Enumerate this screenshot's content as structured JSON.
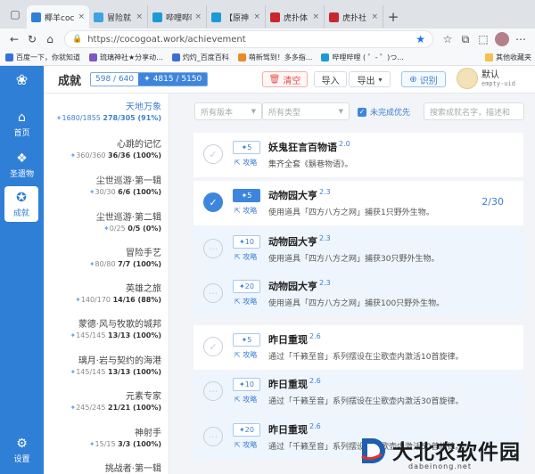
{
  "browser": {
    "tabs": [
      {
        "title": "椰羊coc",
        "color": "#2f7fd6",
        "active": true
      },
      {
        "title": "冒险就",
        "color": "#3ea3e0"
      },
      {
        "title": "哔哩哔哩",
        "color": "#1c9ad6"
      },
      {
        "title": "【原神",
        "color": "#1c9ad6"
      },
      {
        "title": "虎扑体",
        "color": "#c9272d"
      },
      {
        "title": "虎扑社",
        "color": "#c9272d"
      }
    ],
    "url": "https://cocogoat.work/achievement",
    "bookmarks": [
      {
        "label": "百度一下，你就知道",
        "color": "#3b6fd8"
      },
      {
        "label": "琉璃神社★分享动...",
        "color": "#7e57c2"
      },
      {
        "label": "灼灼_百度百科",
        "color": "#3b6fd8"
      },
      {
        "label": "萌新驾到！多多指...",
        "color": "#e98a2b"
      },
      {
        "label": "哔哩哔哩 ( ゜- ゜)つ...",
        "color": "#1c9ad6"
      }
    ],
    "bookmarks_right": "其他收藏夹"
  },
  "header": {
    "title": "成就",
    "count": "598 / 640",
    "primogems": "4815 / 5150",
    "clear": "清空",
    "import": "导入",
    "export": "导出",
    "recognize": "识别",
    "user_name": "默认",
    "user_uid": "empty-uid"
  },
  "sidebar": [
    {
      "label": "首页",
      "icon": "home-icon",
      "glyph": "⌂"
    },
    {
      "label": "圣遗物",
      "icon": "artifact-icon",
      "glyph": "❖"
    },
    {
      "label": "成就",
      "icon": "achievement-icon",
      "glyph": "✪",
      "active": true
    },
    {
      "label": "设置",
      "icon": "gear-icon",
      "glyph": "⚙"
    }
  ],
  "categories": [
    {
      "name": "天地万象",
      "primo": "1680/1855",
      "count": "278/305 (91%)",
      "active": true
    },
    {
      "name": "心跳的记忆",
      "primo": "360/360",
      "count": "36/36 (100%)"
    },
    {
      "name": "尘世巡游·第一辑",
      "primo": "30/30",
      "count": "6/6 (100%)"
    },
    {
      "name": "尘世巡游·第二辑",
      "primo": "0/25",
      "count": "0/5 (0%)"
    },
    {
      "name": "冒险手艺",
      "primo": "80/80",
      "count": "7/7 (100%)"
    },
    {
      "name": "英雄之旅",
      "primo": "140/170",
      "count": "14/16 (88%)"
    },
    {
      "name": "蒙德·风与牧歌的城邦",
      "primo": "145/145",
      "count": "13/13 (100%)"
    },
    {
      "name": "璃月·岩与契约的海港",
      "primo": "145/145",
      "count": "13/13 (100%)"
    },
    {
      "name": "元素专家",
      "primo": "245/245",
      "count": "21/21 (100%)"
    },
    {
      "name": "神射手",
      "primo": "15/15",
      "count": "3/3 (100%)"
    },
    {
      "name": "挑战者·第一辑"
    }
  ],
  "filters": {
    "version": "所有版本",
    "type": "所有类型",
    "incomplete_first": "未完成优先",
    "search_placeholder": "搜索成就名字，描述和"
  },
  "achievements": [
    {
      "reward": "5",
      "title": "妖鬼狂言百物语",
      "version": "2.0",
      "desc": "集齐全套《鬍巷物语》。",
      "guide": "攻略",
      "done": false,
      "sub": false
    },
    {
      "reward": "5",
      "title": "动物园大亨",
      "version": "2.3",
      "desc": "使用道具「四方八方之网」捕获1只野外生物。",
      "guide": "攻略",
      "done": true,
      "sub": false,
      "progress": "2/30"
    },
    {
      "reward": "10",
      "title": "动物园大亨",
      "version": "2.3",
      "desc": "使用道具「四方八方之网」捕获30只野外生物。",
      "guide": "攻略",
      "done": false,
      "sub": true
    },
    {
      "reward": "20",
      "title": "动物园大亨",
      "version": "2.3",
      "desc": "使用道具「四方八方之网」捕获100只野外生物。",
      "guide": "攻略",
      "done": false,
      "sub": true
    },
    {
      "reward": "5",
      "title": "昨日重现",
      "version": "2.6",
      "desc": "通过「千籁至音」系列摆设在尘歌壶内激活10首旋律。",
      "guide": "攻略",
      "done": false,
      "sub": false
    },
    {
      "reward": "10",
      "title": "昨日重现",
      "version": "2.6",
      "desc": "通过「千籁至音」系列摆设在尘歌壶内激活30首旋律。",
      "guide": "攻略",
      "done": false,
      "sub": true
    },
    {
      "reward": "20",
      "title": "昨日重现",
      "version": "2.6",
      "desc": "通过「千籁至音」系列摆设在尘歌壶内激活50首旋律。",
      "guide": "攻略",
      "done": false,
      "sub": true
    }
  ],
  "watermark": {
    "text": "大北农软件园",
    "domain": "dabeinong.net"
  }
}
